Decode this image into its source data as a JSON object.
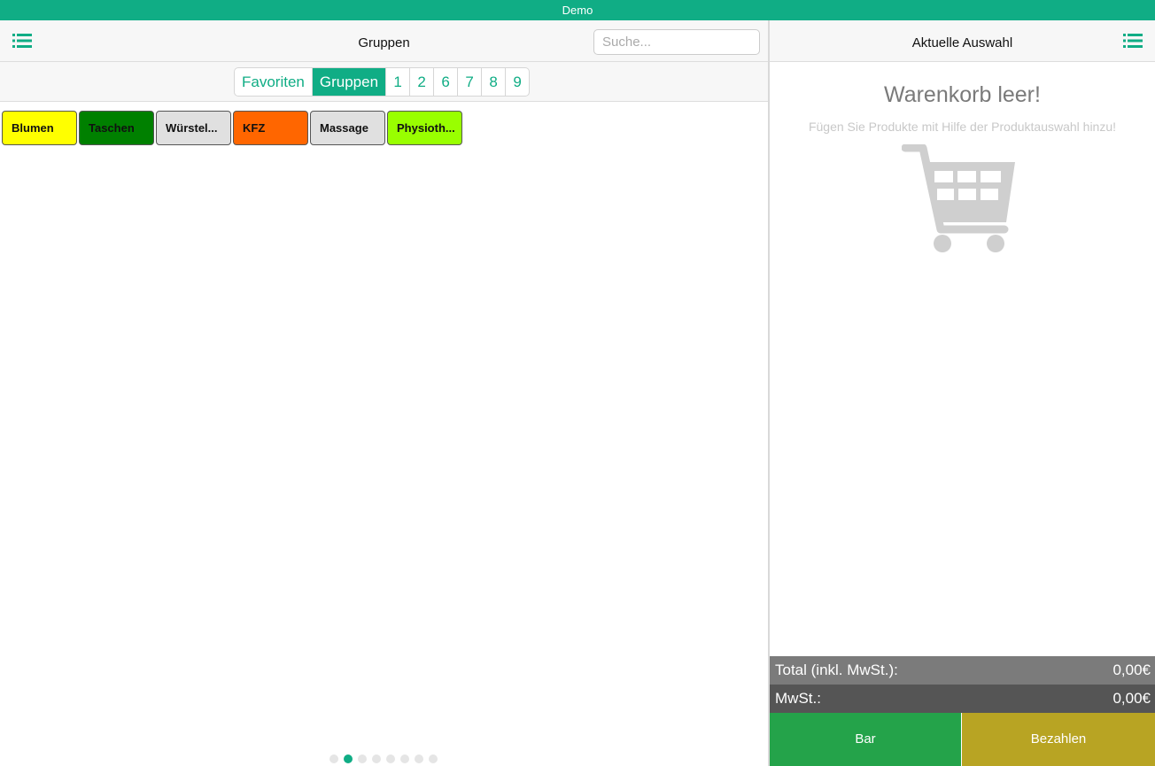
{
  "window": {
    "title": "Demo"
  },
  "left": {
    "title": "Gruppen",
    "menu_icon": "list-icon",
    "search": {
      "placeholder": "Suche...",
      "value": ""
    },
    "tabs": [
      {
        "label": "Favoriten",
        "active": false
      },
      {
        "label": "Gruppen",
        "active": true
      },
      {
        "label": "1",
        "active": false
      },
      {
        "label": "2",
        "active": false
      },
      {
        "label": "6",
        "active": false
      },
      {
        "label": "7",
        "active": false
      },
      {
        "label": "8",
        "active": false
      },
      {
        "label": "9",
        "active": false
      }
    ],
    "groups": [
      {
        "label": "Blumen",
        "color": "#ffff00"
      },
      {
        "label": "Taschen",
        "color": "#008000"
      },
      {
        "label": "Würstel...",
        "color": "#e0e0e0"
      },
      {
        "label": "KFZ",
        "color": "#ff6600"
      },
      {
        "label": "Massage",
        "color": "#e0e0e0"
      },
      {
        "label": "Physioth...",
        "color": "#99ff00"
      }
    ],
    "pagination": {
      "pages": 8,
      "current": 2
    }
  },
  "right": {
    "title": "Aktuelle Auswahl",
    "menu_icon": "list-icon",
    "empty_title": "Warenkorb leer!",
    "empty_subtitle": "Fügen Sie Produkte mit Hilfe der Produktauswahl hinzu!",
    "cart_icon": "shopping-cart-icon",
    "total_label": "Total (inkl. MwSt.):",
    "total_value": "0,00€",
    "mwst_label": "MwSt.:",
    "mwst_value": "0,00€",
    "bar_label": "Bar",
    "pay_label": "Bezahlen"
  },
  "colors": {
    "accent": "#10ad85",
    "bar": "#24a34a",
    "pay": "#b8a423"
  }
}
